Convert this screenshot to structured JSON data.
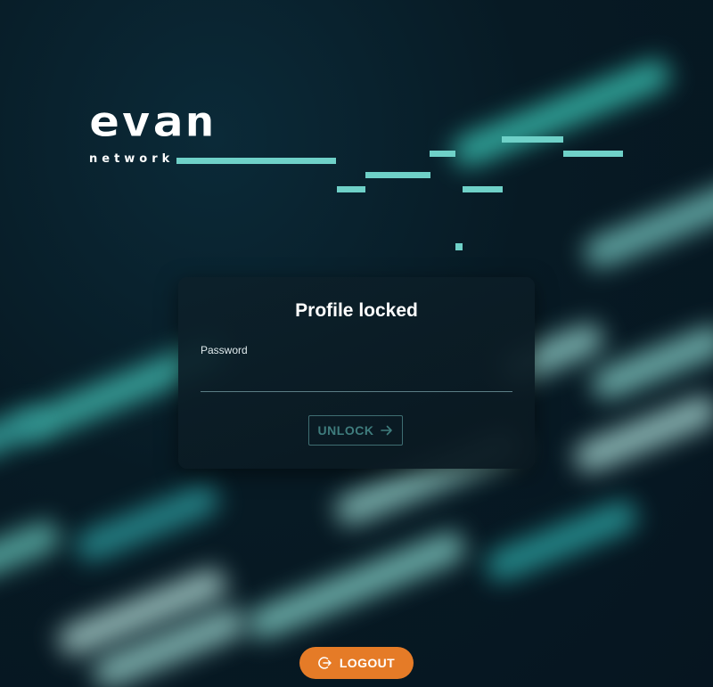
{
  "brand": {
    "name": "evan",
    "tagline": "network"
  },
  "unlock_card": {
    "title": "Profile locked",
    "password_label": "Password",
    "password_value": "",
    "unlock_label": "UNLOCK"
  },
  "footer": {
    "logout_label": "LOGOUT"
  },
  "icons": {
    "unlock": "arrow-right-icon",
    "logout": "logout-icon"
  },
  "colors": {
    "accent_teal": "#6fd1c8",
    "logout_orange": "#e57b27",
    "card_bg": "#0c202a"
  }
}
